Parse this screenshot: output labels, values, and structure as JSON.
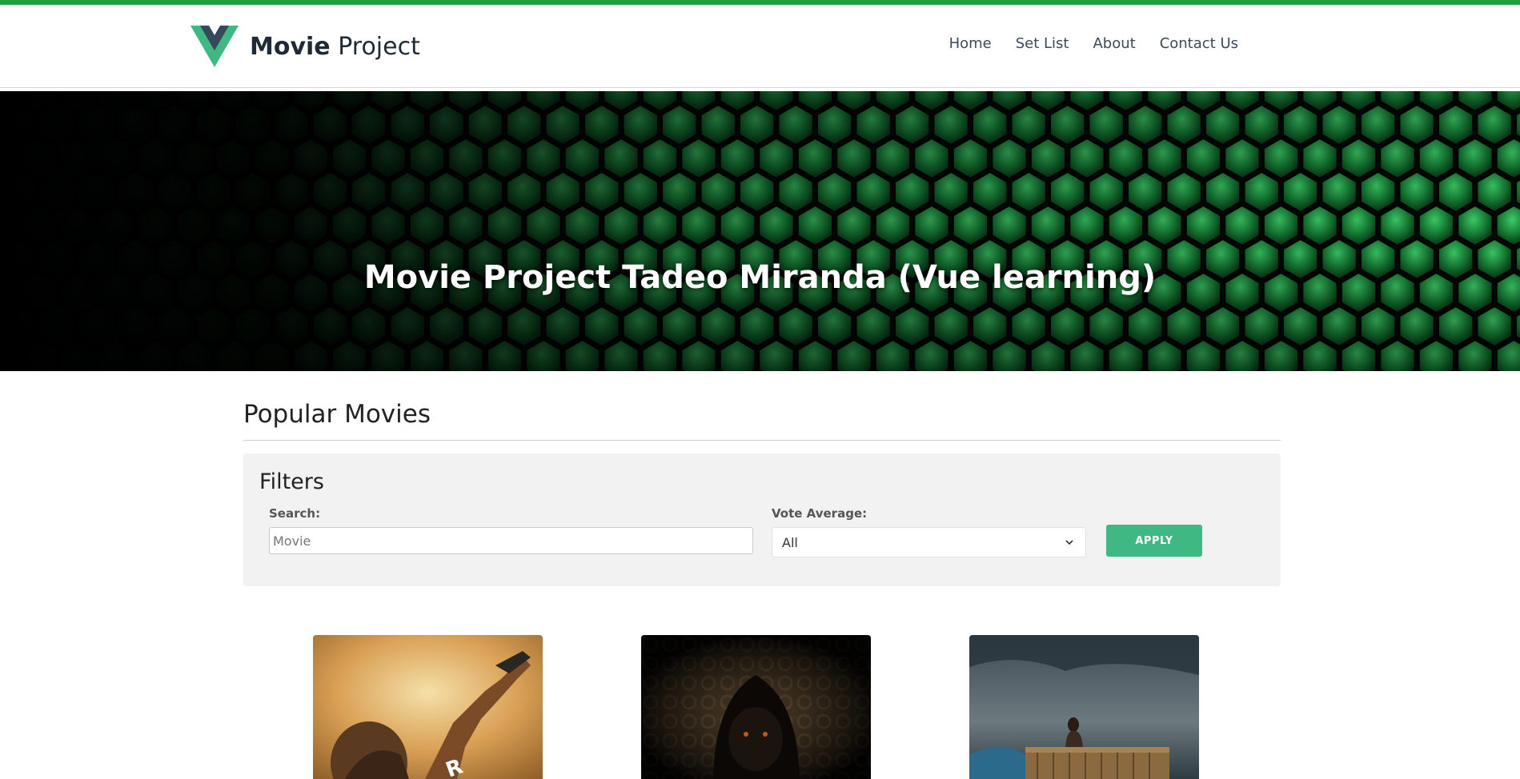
{
  "header": {
    "brand_bold": "Movie",
    "brand_light": "Project",
    "nav": [
      {
        "label": "Home"
      },
      {
        "label": "Set List"
      },
      {
        "label": "About"
      },
      {
        "label": "Contact Us"
      }
    ]
  },
  "hero": {
    "title": "Movie Project Tadeo Miranda (Vue learning)"
  },
  "main": {
    "section_title": "Popular Movies",
    "filters": {
      "title": "Filters",
      "search_label": "Search:",
      "search_placeholder": "Movie",
      "search_value": "",
      "vote_label": "Vote Average:",
      "vote_selected": "All",
      "apply_label": "APPLY"
    },
    "movies": [
      {
        "poster": "action-gun-poster"
      },
      {
        "poster": "dark-hooded-figure-poster"
      },
      {
        "poster": "woman-on-shipping-container-poster"
      }
    ]
  },
  "colors": {
    "accent_green": "#1f9e3c",
    "button_green": "#3fb884",
    "vue_green": "#41b883",
    "vue_dark": "#35495e"
  }
}
